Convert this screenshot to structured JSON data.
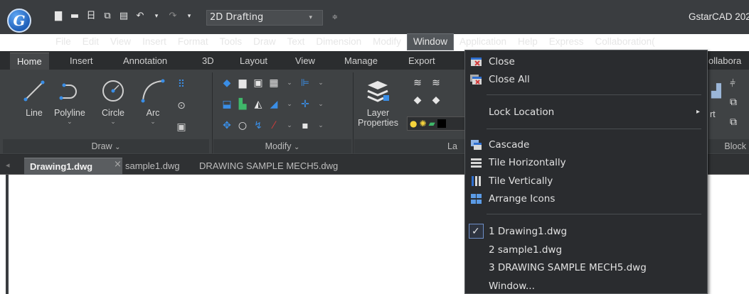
{
  "app": {
    "title": "GstarCAD 202",
    "workspace": "2D Drafting",
    "logo_letter": "G"
  },
  "quick_access": {
    "icons": [
      "new-icon",
      "open-icon",
      "save-icon",
      "save-as-icon",
      "print-icon",
      "undo-icon",
      "redo-icon"
    ]
  },
  "menubar": {
    "items": [
      "File",
      "Edit",
      "View",
      "Insert",
      "Format",
      "Tools",
      "Draw",
      "Text",
      "Dimension",
      "Modify",
      "Window",
      "Application",
      "Help",
      "Express",
      "Collaboration("
    ],
    "active": "Window"
  },
  "ribbon_tabs": {
    "items": [
      "Home",
      "Insert",
      "Annotation",
      "3D",
      "Layout",
      "View",
      "Manage",
      "Export",
      "ollabora"
    ]
  },
  "ribbon": {
    "draw": {
      "title": "Draw",
      "tools": [
        "Line",
        "Polyline",
        "Circle",
        "Arc"
      ]
    },
    "modify": {
      "title": "Modify"
    },
    "layer": {
      "title": "La",
      "properties_line1": "Layer",
      "properties_line2": "Properties"
    },
    "block": {
      "title": "Block",
      "insert_frag": "rt"
    }
  },
  "documents": {
    "tabs": [
      "Drawing1.dwg",
      "sample1.dwg",
      "DRAWING SAMPLE MECH5.dwg"
    ],
    "active": "Drawing1.dwg"
  },
  "window_menu": {
    "close": "Close",
    "close_all": "Close All",
    "lock_location": "Lock Location",
    "cascade": "Cascade",
    "tile_horizontally": "Tile Horizontally",
    "tile_vertically": "Tile Vertically",
    "arrange_icons": "Arrange Icons",
    "open_windows": [
      "1 Drawing1.dwg",
      "2 sample1.dwg",
      "3 DRAWING SAMPLE MECH5.dwg"
    ],
    "more": "Window..."
  },
  "colors": {
    "titlebar": "#3a3d40",
    "ribbon": "#3f4244",
    "menu_bg": "#2a2c2f",
    "accent_blue": "#2f6fd0",
    "red_icon": "#d23b3b"
  }
}
